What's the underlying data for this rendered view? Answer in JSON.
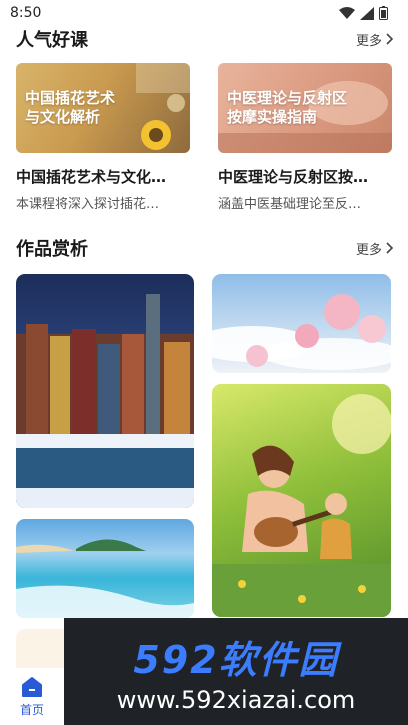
{
  "status": {
    "time": "8:50"
  },
  "popular": {
    "title": "人气好课",
    "more": "更多",
    "courses": [
      {
        "thumb_text": "中国插花艺术\n与文化解析",
        "title": "中国插花艺术与文化…",
        "desc": "本课程将深入探讨插花…"
      },
      {
        "thumb_text": "中医理论与反射区\n按摩实操指南",
        "title": "中医理论与反射区按…",
        "desc": "涵盖中医基础理论至反…"
      }
    ]
  },
  "works": {
    "title": "作品赏析",
    "more": "更多"
  },
  "tabbar": {
    "home_label": "首页"
  },
  "watermark": {
    "main": "592软件园",
    "url": "www.592xiazai.com"
  },
  "colors": {
    "accent": "#2a5bd7",
    "watermark_bg": "#1f2227",
    "watermark_text": "#3c7dff"
  }
}
